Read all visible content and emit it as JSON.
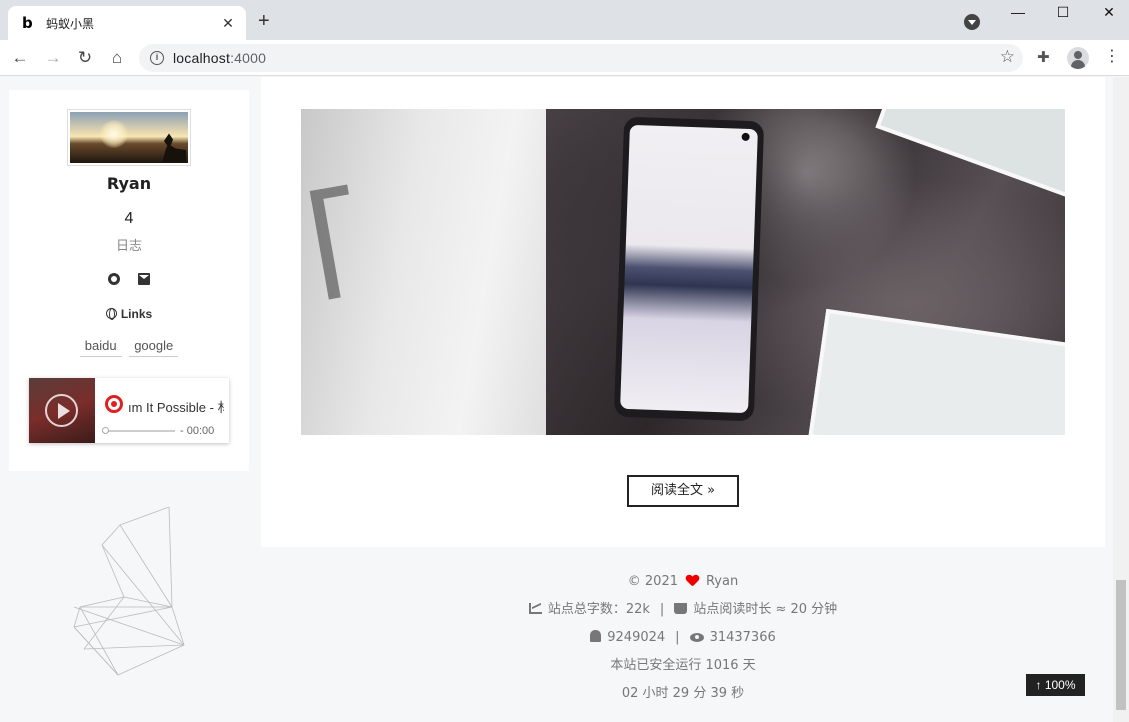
{
  "browser": {
    "tab_title": "蚂蚁小黑",
    "tab_favicon": "b",
    "new_tab_symbol": "+",
    "url_host": "localhost",
    "url_port": ":4000",
    "window_buttons": {
      "minimize": "—",
      "maximize": "☐",
      "close": "✕"
    }
  },
  "sidebar": {
    "author": "Ryan",
    "post_count": "4",
    "post_label": "日志",
    "links_title": "Links",
    "links": [
      "baidu",
      "google"
    ],
    "player": {
      "song_title": "ım It Possible - 林",
      "time": "- 00:00"
    }
  },
  "main": {
    "read_more": "阅读全文 »"
  },
  "footer": {
    "copyright": "© 2021",
    "owner": "Ryan",
    "word_count_label": "站点总字数：",
    "word_count": "22k",
    "read_time_label": "站点阅读时长 ≈",
    "read_time": "20 分钟",
    "visitors": "9249024",
    "views": "31437366",
    "uptime": "本站已安全运行 1016 天",
    "uptime_time": "02 小时 29 分 39 秒"
  },
  "back_to_top": "↑ 100%",
  "icons": [
    "github-icon",
    "mail-icon",
    "globe-icon",
    "play-icon",
    "netease-icon",
    "heart-icon",
    "chart-icon",
    "coffee-icon",
    "user-icon",
    "eye-icon"
  ],
  "colors": {
    "heart": "#e00000",
    "netease": "#e02020"
  }
}
